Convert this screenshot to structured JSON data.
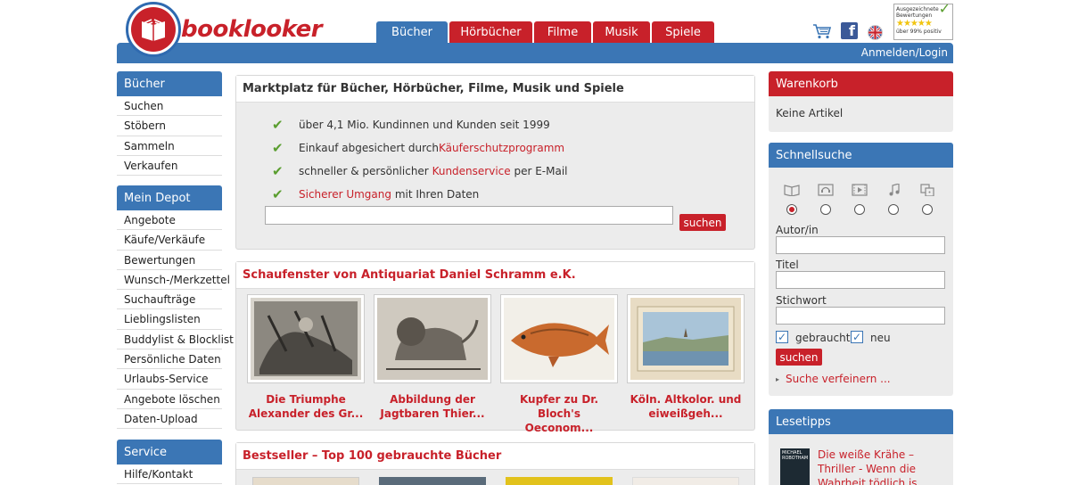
{
  "brand": {
    "name": "booklooker"
  },
  "tabs": [
    {
      "label": "Bücher",
      "active": true
    },
    {
      "label": "Hörbücher",
      "active": false
    },
    {
      "label": "Filme",
      "active": false
    },
    {
      "label": "Musik",
      "active": false
    },
    {
      "label": "Spiele",
      "active": false
    }
  ],
  "header": {
    "login": "Anmelden/Login",
    "rating_badge": {
      "line1": "Ausgezeichnete",
      "line2": "Bewertungen",
      "stars": "★★★★★",
      "line3": "über 99% positiv"
    },
    "icons": [
      "cart-icon",
      "facebook-icon",
      "uk-flag-icon"
    ]
  },
  "left_nav": {
    "sections": [
      {
        "title": "Bücher",
        "items": [
          "Suchen",
          "Stöbern",
          "Sammeln",
          "Verkaufen"
        ]
      },
      {
        "title": "Mein Depot",
        "items": [
          "Angebote",
          "Käufe/Verkäufe",
          "Bewertungen",
          "Wunsch-/Merkzettel",
          "Suchaufträge",
          "Lieblingslisten",
          "Buddylist & Blocklist",
          "Persönliche Daten",
          "Urlaubs-Service",
          "Angebote löschen",
          "Daten-Upload"
        ]
      },
      {
        "title": "Service",
        "items": [
          "Hilfe/Kontakt"
        ]
      }
    ]
  },
  "marketplace": {
    "title": "Marktplatz für Bücher, Hörbücher, Filme, Musik und Spiele",
    "features": [
      {
        "pre": "über 4,1 Mio. Kundinnen und Kunden seit 1999",
        "link": "",
        "post": ""
      },
      {
        "pre": "Einkauf abgesichert durch ",
        "link": "Käuferschutzprogramm",
        "post": ""
      },
      {
        "pre": "schneller & persönlicher ",
        "link": "Kundenservice",
        "post": " per E-Mail"
      },
      {
        "pre": "",
        "link": "Sicherer Umgang",
        "post": " mit Ihren Daten"
      }
    ],
    "search_value": "",
    "search_button": "suchen"
  },
  "showcase": {
    "title": "Schaufenster von Antiquariat Daniel Schramm e.K.",
    "products": [
      {
        "line1": "Die Triumphe",
        "line2": "Alexander des Gr..."
      },
      {
        "line1": "Abbildung der",
        "line2": "Jagtbaren Thier..."
      },
      {
        "line1": "Kupfer zu Dr. Bloch's",
        "line2": "Oeconom..."
      },
      {
        "line1": "Köln. Altkolor. und",
        "line2": "eiweißgeh..."
      }
    ]
  },
  "bestseller": {
    "title": "Bestseller – Top 100 gebrauchte Bücher"
  },
  "cart": {
    "title": "Warenkorb",
    "empty_text": "Keine Artikel"
  },
  "quicksearch": {
    "title": "Schnellsuche",
    "type_icons": [
      "book-icon",
      "audiobook-icon",
      "film-icon",
      "music-icon",
      "game-icon"
    ],
    "selected_type_index": 0,
    "author_label": "Autor/in",
    "title_label": "Titel",
    "keyword_label": "Stichwort",
    "author_value": "",
    "title_value": "",
    "keyword_value": "",
    "used_label": "gebraucht",
    "used_checked": true,
    "new_label": "neu",
    "new_checked": true,
    "button": "suchen",
    "refine_link": "Suche verfeinern ..."
  },
  "reading_tips": {
    "title": "Lesetipps",
    "item": {
      "title": "Die weiße Krähe – Thriller - Wenn die Wahrheit tödlich is...",
      "cover_author": "MICHAEL ROBOTHAM"
    }
  },
  "colors": {
    "brand_red": "#c8212a",
    "brand_blue": "#3b76b5",
    "check_green": "#5a9e2f",
    "panel_gray": "#ececec"
  }
}
